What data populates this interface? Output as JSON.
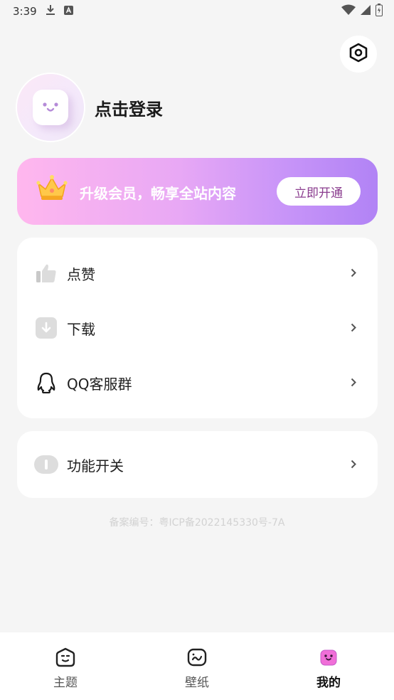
{
  "status_bar": {
    "time": "3:39"
  },
  "profile": {
    "login_label": "点击登录"
  },
  "vip": {
    "promo_text": "升级会员，畅享全站内容",
    "button_label": "立即开通"
  },
  "menu": {
    "items": [
      {
        "label": "点赞",
        "icon": "thumbs-up-icon"
      },
      {
        "label": "下载",
        "icon": "download-icon"
      },
      {
        "label": "QQ客服群",
        "icon": "qq-penguin-icon"
      }
    ],
    "settings_items": [
      {
        "label": "功能开关",
        "icon": "toggle-icon"
      }
    ]
  },
  "footer": {
    "icp": "备案编号：粤ICP备2022145330号-7A"
  },
  "tabs": [
    {
      "label": "主题",
      "icon": "theme-face-icon",
      "active": false
    },
    {
      "label": "壁纸",
      "icon": "wallpaper-face-icon",
      "active": false
    },
    {
      "label": "我的",
      "icon": "mine-face-icon",
      "active": true
    }
  ],
  "colors": {
    "accent": "#b183f5",
    "banner_start": "#ffb7ee",
    "vip_button_text": "#8a3c8e"
  }
}
